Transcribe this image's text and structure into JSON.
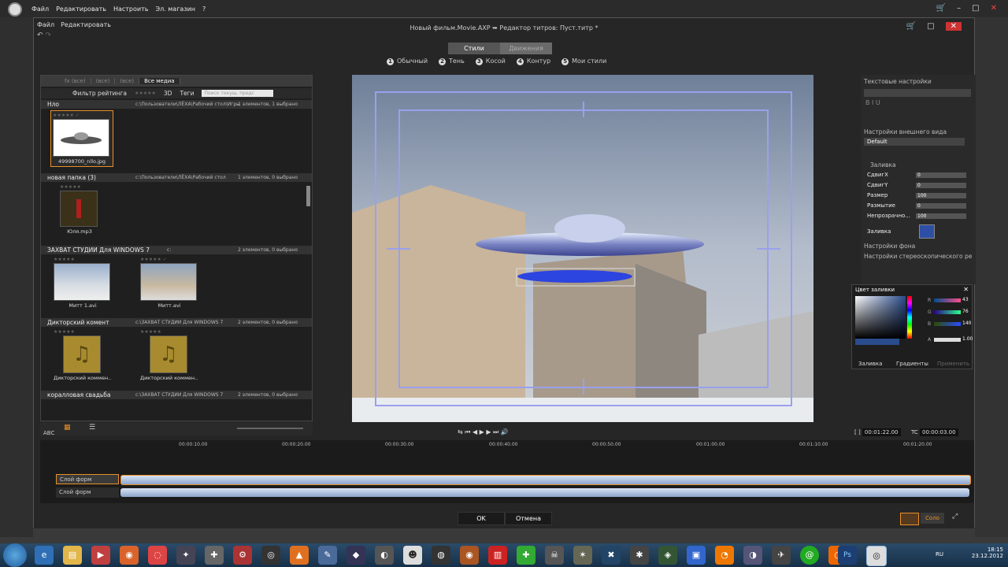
{
  "outer_menu": {
    "items": [
      "Файл",
      "Редактировать",
      "Настроить",
      "Эл. магазин",
      "?"
    ]
  },
  "dialog": {
    "menu": [
      "Файл",
      "Редактировать"
    ],
    "title": "Новый фильм.Movie.AXP",
    "title_arrow": "➥",
    "subtitle": "Редактор титров: Пуст.титр",
    "title_star": "*"
  },
  "tabs": [
    {
      "label": "Стили",
      "active": true
    },
    {
      "label": "Движения",
      "active": false
    }
  ],
  "styles": [
    {
      "num": "1",
      "label": "Обычный"
    },
    {
      "num": "2",
      "label": "Тень"
    },
    {
      "num": "3",
      "label": "Косой"
    },
    {
      "num": "4",
      "label": "Контур"
    },
    {
      "num": "5",
      "label": "Мои стили"
    }
  ],
  "library": {
    "tabs": [
      "fx (все)",
      "(все)",
      "(все)",
      "Все медиа"
    ],
    "filter_label": "Фильтр рейтинга",
    "filter_3d": "3D",
    "filter_tags": "Теги",
    "search_placeholder": "Поиск текущ. предс",
    "groups": [
      {
        "title": "Нло",
        "path": "c:\\Пользователи\\ЛЁХА\\Рабочий стол\\Игры",
        "count": "1 элементов, 1 выбрано",
        "items": [
          "49998700_nllo.jpg"
        ]
      },
      {
        "title": "новая папка (3)",
        "path": "c:\\Пользователи\\ЛЁХА\\Рабочий стол",
        "count": "1 элементов, 0 выбрано",
        "items": [
          "Юля.mp3"
        ]
      },
      {
        "title": "ЗАХВАТ СТУДИИ Для WINDOWS 7",
        "path": "c:",
        "count": "2 элементов, 0 выбрано",
        "items": [
          "Митт 1.avi",
          "Митт.avi"
        ]
      },
      {
        "title": "Дикторский комент",
        "path": "c:\\ЗАХВАТ СТУДИИ Для WINDOWS 7",
        "count": "2 элементов, 0 выбрано",
        "items": [
          "Дикторский коммен...",
          "Дикторский коммен..."
        ]
      },
      {
        "title": "коралловая свадьба",
        "path": "c:\\ЗАХВАТ СТУДИИ Для WINDOWS 7",
        "count": "2 элементов, 0 выбрано",
        "items": []
      }
    ]
  },
  "rpanel": {
    "text_settings": "Текстовые настройки",
    "appearance": "Настройки внешнего вида",
    "preset": "Default",
    "fill_section": "Заливка",
    "rows": [
      {
        "label": "СдвигX",
        "value": "0"
      },
      {
        "label": "СдвигY",
        "value": "0"
      },
      {
        "label": "Размер",
        "value": "100"
      },
      {
        "label": "Размытие",
        "value": "0"
      },
      {
        "label": "Непрозрачно...",
        "value": "100"
      }
    ],
    "fill_label": "Заливка",
    "fill_color": "#2e4fa6",
    "bg_settings": "Настройки фона",
    "stereo_settings": "Настройки стереоскопического ре"
  },
  "colorpicker": {
    "title": "Цвет заливки",
    "rgb": [
      {
        "ch": "R",
        "value": "43"
      },
      {
        "ch": "G",
        "value": "76"
      },
      {
        "ch": "B",
        "value": "140"
      }
    ],
    "alpha_label": "A",
    "alpha": "1.00",
    "tabs": [
      "Заливка",
      "Градиенты"
    ],
    "apply": "Применить"
  },
  "timecodes": {
    "pos_label": "[ ]",
    "pos": "00:01:22.00",
    "tc_label": "TC",
    "tc": "00:00:03.00"
  },
  "ruler": [
    "00:00:10.00",
    "00:00:20.00",
    "00:00:30.00",
    "00:00:40.00",
    "00:00:50.00",
    "00:01:00.00",
    "00:01:10.00",
    "00:01:20.00"
  ],
  "tracks": [
    {
      "name": "Слой форм"
    },
    {
      "name": "Слой форм"
    }
  ],
  "footer": {
    "ok": "OK",
    "cancel": "Отмена",
    "solo": "Соло"
  },
  "tray": {
    "lang": "RU",
    "time": "18:15",
    "date": "23.12.2012"
  }
}
